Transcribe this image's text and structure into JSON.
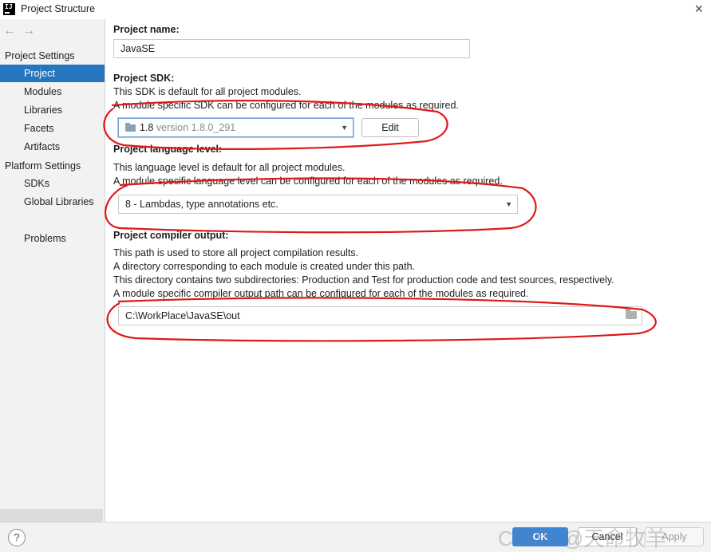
{
  "window": {
    "title": "Project Structure",
    "app_icon_text": "IJ"
  },
  "nav": {
    "back_glyph": "←",
    "forward_glyph": "→"
  },
  "sidebar": {
    "project_settings_header": "Project Settings",
    "project_settings_items": [
      {
        "label": "Project",
        "selected": true
      },
      {
        "label": "Modules"
      },
      {
        "label": "Libraries"
      },
      {
        "label": "Facets"
      },
      {
        "label": "Artifacts"
      }
    ],
    "platform_settings_header": "Platform Settings",
    "platform_settings_items": [
      {
        "label": "SDKs"
      },
      {
        "label": "Global Libraries"
      }
    ],
    "problems_label": "Problems"
  },
  "project_name": {
    "label": "Project name:",
    "value": "JavaSE"
  },
  "project_sdk": {
    "label": "Project SDK:",
    "desc1": "This SDK is default for all project modules.",
    "desc2": "A module specific SDK can be configured for each of the modules as required.",
    "selected_name": "1.8",
    "selected_version": "version 1.8.0_291",
    "edit_label": "Edit"
  },
  "language_level": {
    "label": "Project language level:",
    "desc1": "This language level is default for all project modules.",
    "desc2": "A module specific language level can be configured for each of the modules as required.",
    "selected": "8 - Lambdas, type annotations etc."
  },
  "compiler_output": {
    "label": "Project compiler output:",
    "desc1": "This path is used to store all project compilation results.",
    "desc2": "A directory corresponding to each module is created under this path.",
    "desc3": "This directory contains two subdirectories: Production and Test for production code and test sources, respectively.",
    "desc4": "A module specific compiler output path can be configured for each of the modules as required.",
    "path": "C:\\WorkPlace\\JavaSE\\out"
  },
  "footer": {
    "help_label": "?",
    "ok_label": "OK",
    "cancel_label": "Cancel",
    "apply_label": "Apply",
    "watermark": "CSDN @天命牧羊"
  },
  "colors": {
    "selection": "#2675bf",
    "ok_button": "#3d86d6",
    "annotation_red": "#e01818"
  }
}
